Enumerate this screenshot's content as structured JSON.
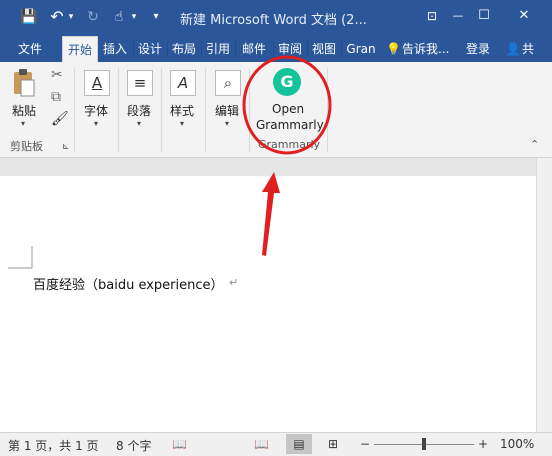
{
  "titlebar": {
    "title": "新建 Microsoft Word 文档 (2...",
    "qat": {
      "save": "💾",
      "undo": "↶",
      "undo_caret": "▾",
      "redo": "↻",
      "touch": "☝",
      "touch_caret": "▾",
      "customize": "▾"
    },
    "window": {
      "ribbon_options": "⊡",
      "minimize": "—",
      "maximize": "☐",
      "close": "✕"
    }
  },
  "tabs": [
    {
      "label": "文件"
    },
    {
      "label": "开始"
    },
    {
      "label": "插入"
    },
    {
      "label": "设计"
    },
    {
      "label": "布局"
    },
    {
      "label": "引用"
    },
    {
      "label": "邮件"
    },
    {
      "label": "审阅"
    },
    {
      "label": "视图"
    },
    {
      "label": "Gran"
    }
  ],
  "tell_me": {
    "icon": "💡",
    "label": "告诉我..."
  },
  "account": {
    "login": "登录",
    "share_icon": "👤",
    "share": "共"
  },
  "ribbon": {
    "clipboard": {
      "paste": "粘贴",
      "group": "剪贴板",
      "cut_icon": "✂",
      "copy_icon": "⧉",
      "painter_icon": "🖌",
      "launcher": "⊾",
      "caret": "▾"
    },
    "font": {
      "label": "字体",
      "icon": "A",
      "caret": "▾"
    },
    "paragraph": {
      "label": "段落",
      "icon": "≡",
      "caret": "▾"
    },
    "styles": {
      "label": "样式",
      "icon": "A",
      "caret": "▾"
    },
    "editing": {
      "label": "编辑",
      "icon": "⌕",
      "caret": "▾"
    },
    "grammarly": {
      "icon_text": "G",
      "button_line1": "Open",
      "button_line2": "Grammarly",
      "group": "Grammarly"
    },
    "collapse": "⌃"
  },
  "document": {
    "text": "百度经验（baidu experience）",
    "paragraph_mark": "↵"
  },
  "statusbar": {
    "page": "第 1 页，共 1 页",
    "words": "8 个字",
    "proofing_icon": "📖",
    "view_read": "📖",
    "view_print": "▤",
    "view_web": "⊞",
    "zoom_out": "−",
    "zoom_in": "+",
    "zoom": "100%",
    "zoom_value": 1.0
  },
  "colors": {
    "brand": "#2b579a",
    "grammarly": "#15c39a",
    "annotation": "#e02020"
  }
}
